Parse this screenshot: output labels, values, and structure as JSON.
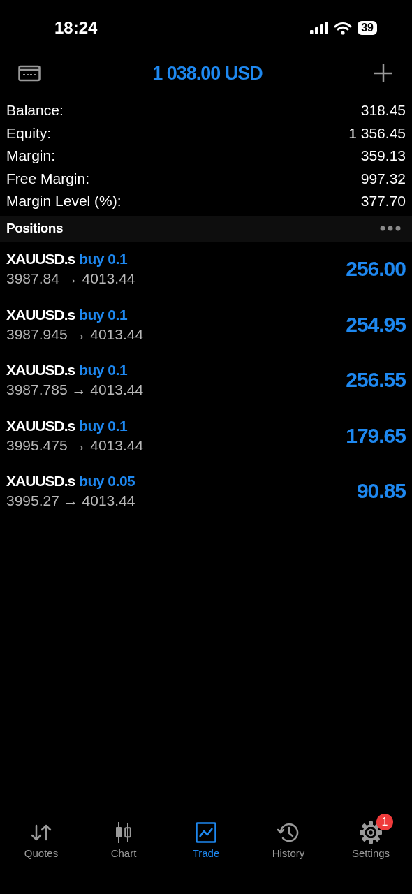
{
  "status_bar": {
    "time": "18:24",
    "battery": "39"
  },
  "header": {
    "title": "1 038.00 USD"
  },
  "summary": [
    {
      "label": "Balance:",
      "value": "318.45"
    },
    {
      "label": "Equity:",
      "value": "1 356.45"
    },
    {
      "label": "Margin:",
      "value": "359.13"
    },
    {
      "label": "Free Margin:",
      "value": "997.32"
    },
    {
      "label": "Margin Level (%):",
      "value": "377.70"
    }
  ],
  "positions": {
    "title": "Positions",
    "rows": [
      {
        "symbol": "XAUUSD.s",
        "side": "buy 0.1",
        "prices": "3987.84 → 4013.44",
        "profit": "256.00"
      },
      {
        "symbol": "XAUUSD.s",
        "side": "buy 0.1",
        "prices": "3987.945 → 4013.44",
        "profit": "254.95"
      },
      {
        "symbol": "XAUUSD.s",
        "side": "buy 0.1",
        "prices": "3987.785 → 4013.44",
        "profit": "256.55"
      },
      {
        "symbol": "XAUUSD.s",
        "side": "buy 0.1",
        "prices": "3995.475 → 4013.44",
        "profit": "179.65"
      },
      {
        "symbol": "XAUUSD.s",
        "side": "buy 0.05",
        "prices": "3995.27 → 4013.44",
        "profit": "90.85"
      }
    ]
  },
  "tabs": [
    {
      "kind": "quotes",
      "label": "Quotes",
      "selected": false
    },
    {
      "kind": "chart",
      "label": "Chart",
      "selected": false
    },
    {
      "kind": "trade",
      "label": "Trade",
      "selected": true
    },
    {
      "kind": "history",
      "label": "History",
      "selected": false
    },
    {
      "kind": "settings",
      "label": "Settings",
      "selected": false,
      "badge": "1"
    }
  ]
}
